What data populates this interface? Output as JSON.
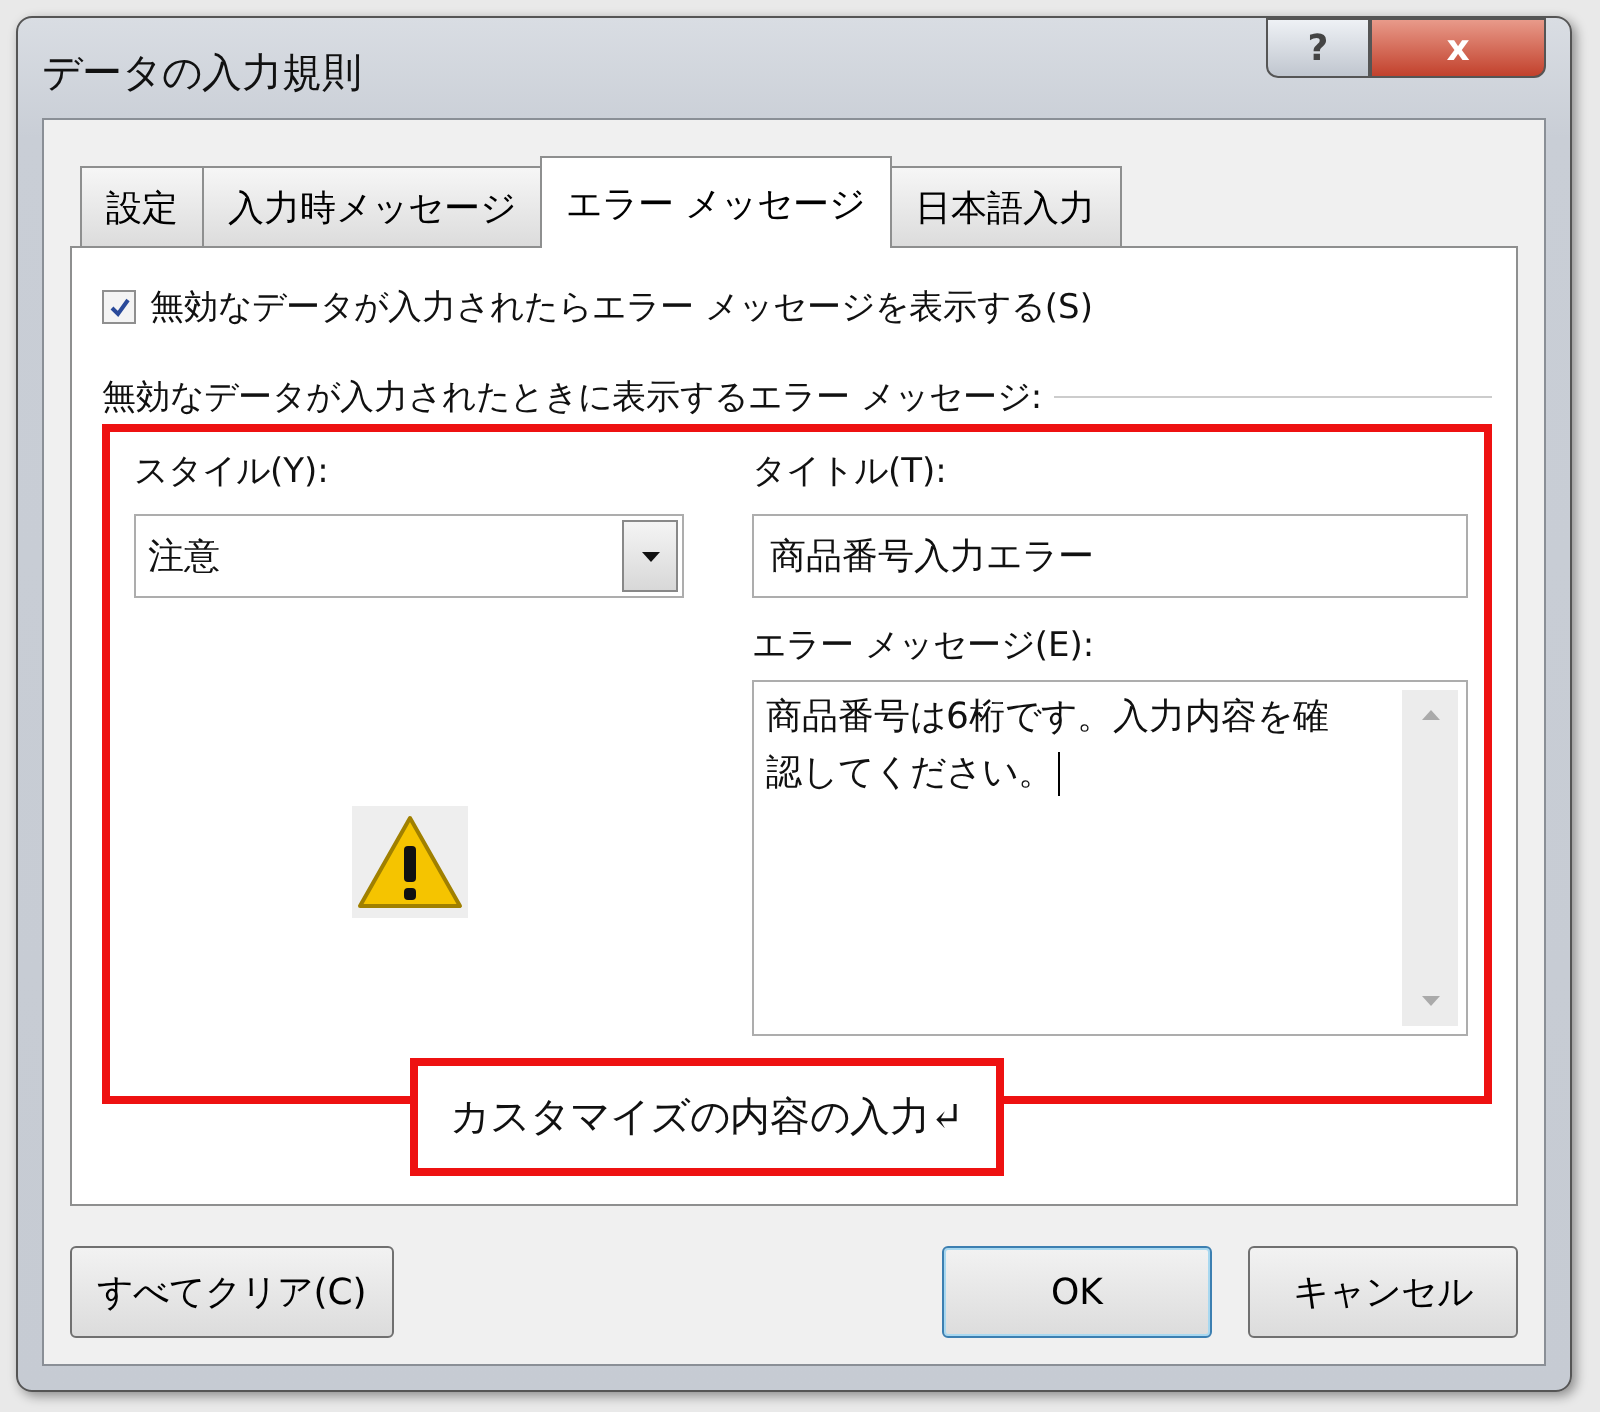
{
  "window": {
    "title": "データの入力規則",
    "help_button": "?",
    "close_button": "x"
  },
  "tabs": [
    {
      "label": "設定",
      "selected": false
    },
    {
      "label": "入力時メッセージ",
      "selected": false
    },
    {
      "label": "エラー メッセージ",
      "selected": true
    },
    {
      "label": "日本語入力",
      "selected": false
    }
  ],
  "show_error": {
    "label": "無効なデータが入力されたらエラー メッセージを表示する(S)",
    "checked": true
  },
  "group_label": "無効なデータが入力されたときに表示するエラー メッセージ:",
  "style": {
    "label": "スタイル(Y):",
    "value": "注意"
  },
  "title_field": {
    "label": "タイトル(T):",
    "value": "商品番号入力エラー"
  },
  "message_field": {
    "label": "エラー メッセージ(E):",
    "value": "商品番号は6桁です。入力内容を確認してください。"
  },
  "callout": "カスタマイズの内容の入力↵",
  "buttons": {
    "clear": "すべてクリア(C)",
    "ok": "OK",
    "cancel": "キャンセル"
  }
}
